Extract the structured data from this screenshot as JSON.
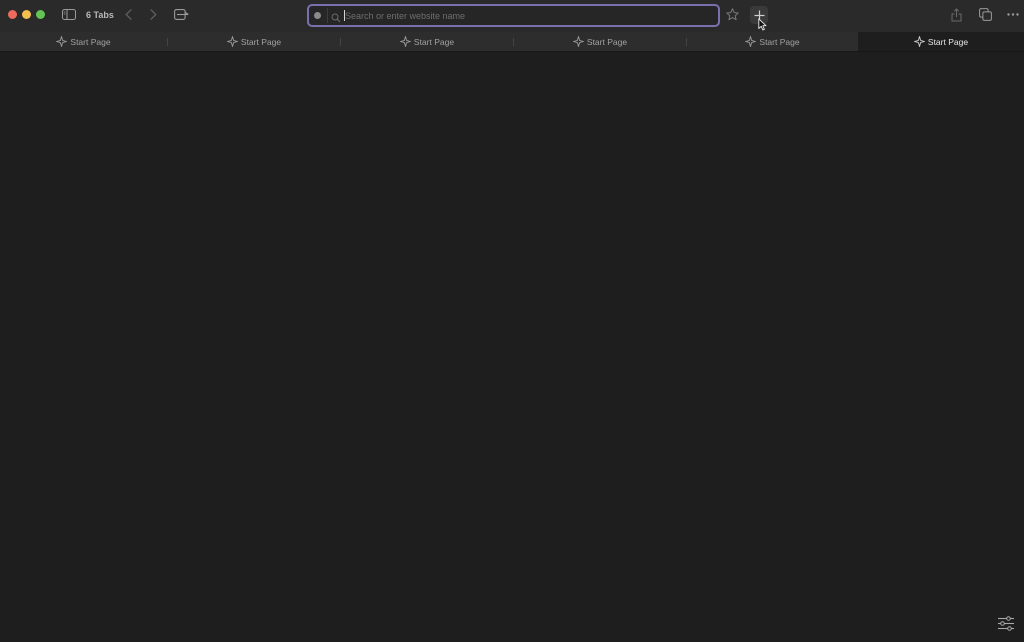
{
  "toolbar": {
    "tab_count_label": "6 Tabs"
  },
  "address_bar": {
    "placeholder": "Search or enter website name",
    "value": ""
  },
  "tabs": [
    {
      "label": "Start Page",
      "active": false
    },
    {
      "label": "Start Page",
      "active": false
    },
    {
      "label": "Start Page",
      "active": false
    },
    {
      "label": "Start Page",
      "active": false
    },
    {
      "label": "Start Page",
      "active": false
    },
    {
      "label": "Start Page",
      "active": true
    }
  ],
  "icons": {
    "sidebar": "sidebar-icon",
    "back": "chevron-left-icon",
    "forward": "chevron-right-icon",
    "tab_overview": "tab-overview-icon",
    "search": "search-icon",
    "bookmark": "star-icon",
    "new_tab": "plus-icon",
    "share": "share-icon",
    "tabs": "tabs-icon",
    "more": "more-icon",
    "start_page": "sparkle-icon",
    "customize": "sliders-icon"
  },
  "colors": {
    "address_focus": "#7b6fae",
    "background": "#1e1e1e",
    "toolbar": "#2a2a2a"
  }
}
